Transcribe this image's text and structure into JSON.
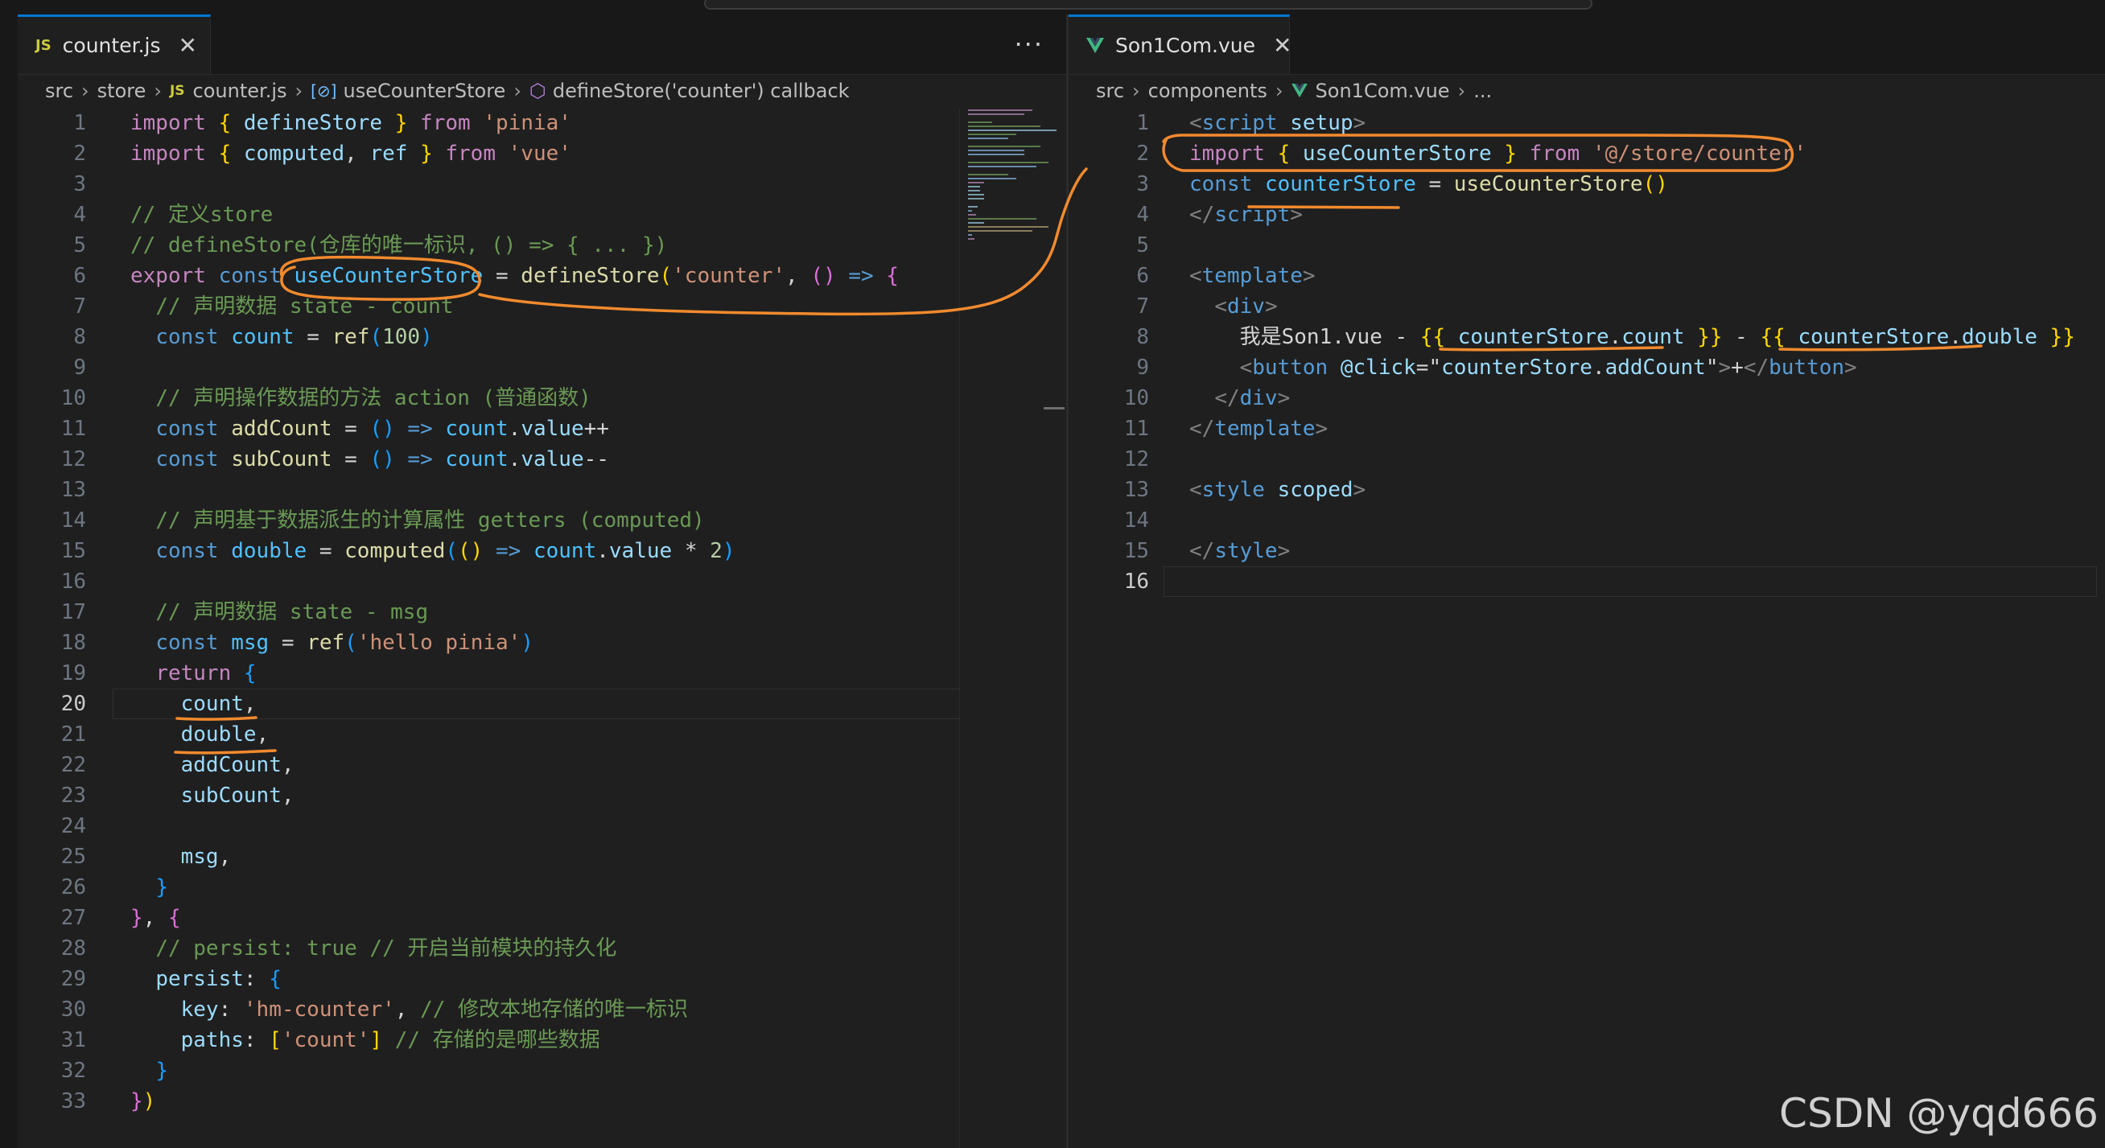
{
  "left_editor": {
    "tab": {
      "icon": "JS",
      "label": "counter.js",
      "close": "✕"
    },
    "more_actions": "···",
    "breadcrumb": [
      "src",
      "store",
      "counter.js",
      "useCounterStore",
      "defineStore('counter') callback"
    ],
    "breadcrumb_js": "JS",
    "current_line": 20,
    "lines": [
      {
        "n": "1",
        "html": "<span class='kw'>import</span> <span class='br1'>{</span> <span class='vr'>defineStore</span> <span class='br1'>}</span> <span class='kw'>from</span> <span class='st'>'pinia'</span>"
      },
      {
        "n": "2",
        "html": "<span class='kw'>import</span> <span class='br1'>{</span> <span class='vr'>computed</span><span class='df'>,</span> <span class='vr'>ref</span> <span class='br1'>}</span> <span class='kw'>from</span> <span class='st'>'vue'</span>"
      },
      {
        "n": "3",
        "html": ""
      },
      {
        "n": "4",
        "html": "<span class='cm'>// 定义store</span>"
      },
      {
        "n": "5",
        "html": "<span class='cm'>// defineStore(仓库的唯一标识, () =&gt; { ... })</span>"
      },
      {
        "n": "6",
        "html": "<span class='kw'>export</span> <span class='kb'>const</span> <span class='cn'>useCounterStore</span> <span class='df'>=</span> <span class='fn'>defineStore</span><span class='br1'>(</span><span class='st'>'counter'</span><span class='df'>,</span> <span class='br2'>()</span> <span class='kb'>=&gt;</span> <span class='br2'>{</span>"
      },
      {
        "n": "7",
        "html": "  <span class='cm'>// 声明数据 state - count</span>"
      },
      {
        "n": "8",
        "html": "  <span class='kb'>const</span> <span class='cn'>count</span> <span class='df'>=</span> <span class='fn'>ref</span><span class='br3'>(</span><span class='nm'>100</span><span class='br3'>)</span>"
      },
      {
        "n": "9",
        "html": ""
      },
      {
        "n": "10",
        "html": "  <span class='cm'>// 声明操作数据的方法 action (普通函数)</span>"
      },
      {
        "n": "11",
        "html": "  <span class='kb'>const</span> <span class='fn'>addCount</span> <span class='df'>=</span> <span class='br3'>()</span> <span class='kb'>=&gt;</span> <span class='cn'>count</span><span class='df'>.</span><span class='vr'>value</span><span class='df'>++</span>"
      },
      {
        "n": "12",
        "html": "  <span class='kb'>const</span> <span class='fn'>subCount</span> <span class='df'>=</span> <span class='br3'>()</span> <span class='kb'>=&gt;</span> <span class='cn'>count</span><span class='df'>.</span><span class='vr'>value</span><span class='df'>--</span>"
      },
      {
        "n": "13",
        "html": ""
      },
      {
        "n": "14",
        "html": "  <span class='cm'>// 声明基于数据派生的计算属性 getters (computed)</span>"
      },
      {
        "n": "15",
        "html": "  <span class='kb'>const</span> <span class='cn'>double</span> <span class='df'>=</span> <span class='fn'>computed</span><span class='br3'>(</span><span class='br1'>()</span> <span class='kb'>=&gt;</span> <span class='cn'>count</span><span class='df'>.</span><span class='vr'>value</span> <span class='df'>*</span> <span class='nm'>2</span><span class='br3'>)</span>"
      },
      {
        "n": "16",
        "html": ""
      },
      {
        "n": "17",
        "html": "  <span class='cm'>// 声明数据 state - msg</span>"
      },
      {
        "n": "18",
        "html": "  <span class='kb'>const</span> <span class='cn'>msg</span> <span class='df'>=</span> <span class='fn'>ref</span><span class='br3'>(</span><span class='st'>'hello pinia'</span><span class='br3'>)</span>"
      },
      {
        "n": "19",
        "html": "  <span class='kw'>return</span> <span class='br3'>{</span>"
      },
      {
        "n": "20",
        "html": "    <span class='vr'>count</span><span class='df'>,</span>"
      },
      {
        "n": "21",
        "html": "    <span class='vr'>double</span><span class='df'>,</span>"
      },
      {
        "n": "22",
        "html": "    <span class='vr'>addCount</span><span class='df'>,</span>"
      },
      {
        "n": "23",
        "html": "    <span class='vr'>subCount</span><span class='df'>,</span>"
      },
      {
        "n": "24",
        "html": ""
      },
      {
        "n": "25",
        "html": "    <span class='vr'>msg</span><span class='df'>,</span>"
      },
      {
        "n": "26",
        "html": "  <span class='br3'>}</span>"
      },
      {
        "n": "27",
        "html": "<span class='br2'>}</span><span class='df'>,</span> <span class='br2'>{</span>"
      },
      {
        "n": "28",
        "html": "  <span class='cm'>// persist: true // 开启当前模块的持久化</span>"
      },
      {
        "n": "29",
        "html": "  <span class='vr'>persist</span><span class='df'>:</span> <span class='br3'>{</span>"
      },
      {
        "n": "30",
        "html": "    <span class='vr'>key</span><span class='df'>:</span> <span class='st'>'hm-counter'</span><span class='df'>,</span> <span class='cm'>// 修改本地存储的唯一标识</span>"
      },
      {
        "n": "31",
        "html": "    <span class='vr'>paths</span><span class='df'>:</span> <span class='br1'>[</span><span class='st'>'count'</span><span class='br1'>]</span> <span class='cm'>// 存储的是哪些数据</span>"
      },
      {
        "n": "32",
        "html": "  <span class='br3'>}</span>"
      },
      {
        "n": "33",
        "html": "<span class='br2'>}</span><span class='br1'>)</span>"
      }
    ]
  },
  "right_editor": {
    "tab": {
      "label": "Son1Com.vue",
      "close": "✕"
    },
    "breadcrumb": [
      "src",
      "components",
      "Son1Com.vue",
      "..."
    ],
    "current_line": 16,
    "lines": [
      {
        "n": "1",
        "html": "<span class='pu'>&lt;</span><span class='tg'>script</span> <span class='vr'>setup</span><span class='pu'>&gt;</span>"
      },
      {
        "n": "2",
        "html": "<span class='kw'>import</span> <span class='br1'>{</span> <span class='vr'>useCounterStore</span> <span class='br1'>}</span> <span class='kw'>from</span> <span class='st'>'@/store/counter'</span>"
      },
      {
        "n": "3",
        "html": "<span class='kb'>const</span> <span class='cn'>counterStore</span> <span class='df'>=</span> <span class='fn'>useCounterStore</span><span class='br1'>()</span>"
      },
      {
        "n": "4",
        "html": "<span class='pu'>&lt;/</span><span class='tg'>script</span><span class='pu'>&gt;</span>"
      },
      {
        "n": "5",
        "html": ""
      },
      {
        "n": "6",
        "html": "<span class='pu'>&lt;</span><span class='tg'>template</span><span class='pu'>&gt;</span>"
      },
      {
        "n": "7",
        "html": "  <span class='pu'>&lt;</span><span class='tg'>div</span><span class='pu'>&gt;</span>"
      },
      {
        "n": "8",
        "html": "    <span class='df'>我是Son1.vue - </span><span class='br1'>{{</span> <span class='vr'>counterStore</span><span class='df'>.</span><span class='vr'>count</span> <span class='br1'>}}</span><span class='df'> - </span><span class='br1'>{{</span> <span class='vr'>counterStore</span><span class='df'>.</span><span class='vr'>double</span> <span class='br1'>}}</span>"
      },
      {
        "n": "9",
        "html": "    <span class='pu'>&lt;</span><span class='tg'>button</span> <span class='vr'>@click</span><span class='df'>=</span><span class='df'>\"</span><span class='vr'>counterStore</span><span class='df'>.</span><span class='vr'>addCount</span><span class='df'>\"</span><span class='pu'>&gt;</span><span class='df'>+</span><span class='pu'>&lt;/</span><span class='tg'>button</span><span class='pu'>&gt;</span>"
      },
      {
        "n": "10",
        "html": "  <span class='pu'>&lt;/</span><span class='tg'>div</span><span class='pu'>&gt;</span>"
      },
      {
        "n": "11",
        "html": "<span class='pu'>&lt;/</span><span class='tg'>template</span><span class='pu'>&gt;</span>"
      },
      {
        "n": "12",
        "html": ""
      },
      {
        "n": "13",
        "html": "<span class='pu'>&lt;</span><span class='tg'>style</span> <span class='vr'>scoped</span><span class='pu'>&gt;</span>"
      },
      {
        "n": "14",
        "html": ""
      },
      {
        "n": "15",
        "html": "<span class='pu'>&lt;/</span><span class='tg'>style</span><span class='pu'>&gt;</span>"
      },
      {
        "n": "16",
        "html": ""
      }
    ]
  },
  "watermark": "CSDN @yqd666",
  "colors": {
    "editor_bg": "#1f1f1f",
    "annotation": "#f28a2e",
    "keyword": "#c586c0",
    "comment": "#6a9955",
    "string": "#ce9178"
  }
}
